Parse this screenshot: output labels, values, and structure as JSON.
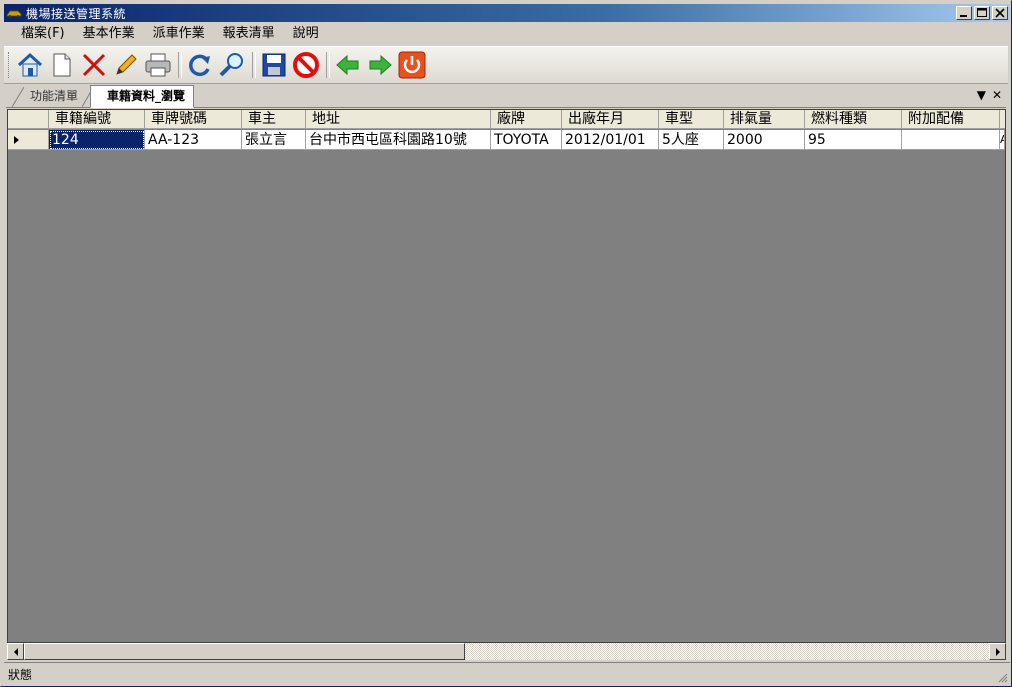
{
  "window": {
    "title": "機場接送管理系統"
  },
  "menu": [
    {
      "label": "檔案(F)"
    },
    {
      "label": "基本作業"
    },
    {
      "label": "派車作業"
    },
    {
      "label": "報表清單"
    },
    {
      "label": "說明"
    }
  ],
  "toolbar": [
    {
      "icon": "home-icon",
      "name": "home-button"
    },
    {
      "icon": "new-document-icon",
      "name": "new-button"
    },
    {
      "icon": "delete-x-icon",
      "name": "delete-button"
    },
    {
      "icon": "pencil-icon",
      "name": "edit-button"
    },
    {
      "icon": "printer-icon",
      "name": "print-button"
    },
    {
      "icon": "refresh-icon",
      "name": "refresh-button"
    },
    {
      "icon": "search-icon",
      "name": "search-button"
    },
    {
      "icon": "save-icon",
      "name": "save-button"
    },
    {
      "icon": "cancel-icon",
      "name": "cancel-button"
    },
    {
      "icon": "arrow-left-icon",
      "name": "previous-button"
    },
    {
      "icon": "arrow-right-icon",
      "name": "next-button"
    },
    {
      "icon": "power-icon",
      "name": "exit-button"
    }
  ],
  "tabs": [
    {
      "label": "功能清單",
      "active": false
    },
    {
      "label": "車籍資料_瀏覽",
      "active": true
    }
  ],
  "grid": {
    "columns": [
      "車籍編號",
      "車牌號碼",
      "車主",
      "地址",
      "廠牌",
      "出廠年月",
      "車型",
      "排氣量",
      "燃料種類",
      "附加配備"
    ],
    "rows": [
      [
        "124",
        "AA-123",
        "張立言",
        "台中市西屯區科園路10號",
        "TOYOTA",
        "2012/01/01",
        "5人座",
        "2000",
        "95",
        ""
      ]
    ],
    "overflow_cell": "A"
  },
  "status": {
    "text": "狀態"
  },
  "colors": {
    "title_start": "#0a246a",
    "title_end": "#a6caf0",
    "selection": "#0a246a",
    "grid_bg": "#808080"
  }
}
